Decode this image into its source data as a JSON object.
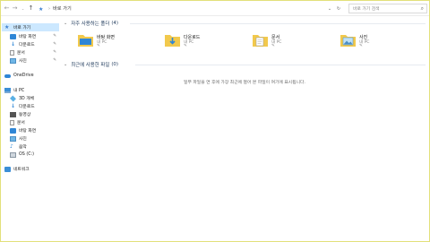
{
  "address": {
    "back_icon": "back-arrow-icon",
    "forward_icon": "forward-arrow-icon",
    "recent_icon": "chevron-down-icon",
    "up_icon": "up-arrow-icon",
    "location": "바로 가기",
    "search_placeholder": "바로 가기 검색"
  },
  "sidebar": {
    "items": [
      {
        "label": "바로 가기",
        "icon": "star-icon",
        "selected": true,
        "pinned": false
      },
      {
        "label": "바탕 화면",
        "icon": "desktop-icon",
        "pinned": true
      },
      {
        "label": "다운로드",
        "icon": "download-icon",
        "pinned": true
      },
      {
        "label": "문서",
        "icon": "document-icon",
        "pinned": true
      },
      {
        "label": "사진",
        "icon": "pictures-icon",
        "pinned": true
      },
      {
        "label": "OneDrive",
        "icon": "cloud-icon"
      },
      {
        "label": "내 PC",
        "icon": "pc-icon"
      },
      {
        "label": "3D 개체",
        "icon": "3d-objects-icon"
      },
      {
        "label": "다운로드",
        "icon": "download-icon"
      },
      {
        "label": "동영상",
        "icon": "video-icon"
      },
      {
        "label": "문서",
        "icon": "document-icon"
      },
      {
        "label": "바탕 화면",
        "icon": "desktop-icon"
      },
      {
        "label": "사진",
        "icon": "pictures-icon"
      },
      {
        "label": "음악",
        "icon": "music-icon"
      },
      {
        "label": "OS (C:)",
        "icon": "drive-icon"
      },
      {
        "label": "네트워크",
        "icon": "network-icon"
      }
    ]
  },
  "frequent": {
    "title": "자주 사용하는 폴더",
    "count": "(4)",
    "folders": [
      {
        "name": "바탕 화면",
        "location": "내 PC"
      },
      {
        "name": "다운로드",
        "location": "내 PC"
      },
      {
        "name": "문서",
        "location": "내 PC"
      },
      {
        "name": "사진",
        "location": "내 PC"
      }
    ]
  },
  "recent": {
    "title": "최근에 사용한 파일",
    "count": "(0)",
    "empty_message": "일부 파일을 연 후에 가장 최근에 열어 본 파일이 여기에 표시됩니다."
  },
  "colors": {
    "selected_bg": "#cce8ff",
    "accent": "#2f86d6",
    "folder": "#f2c94c",
    "border": "#e3e07a"
  }
}
